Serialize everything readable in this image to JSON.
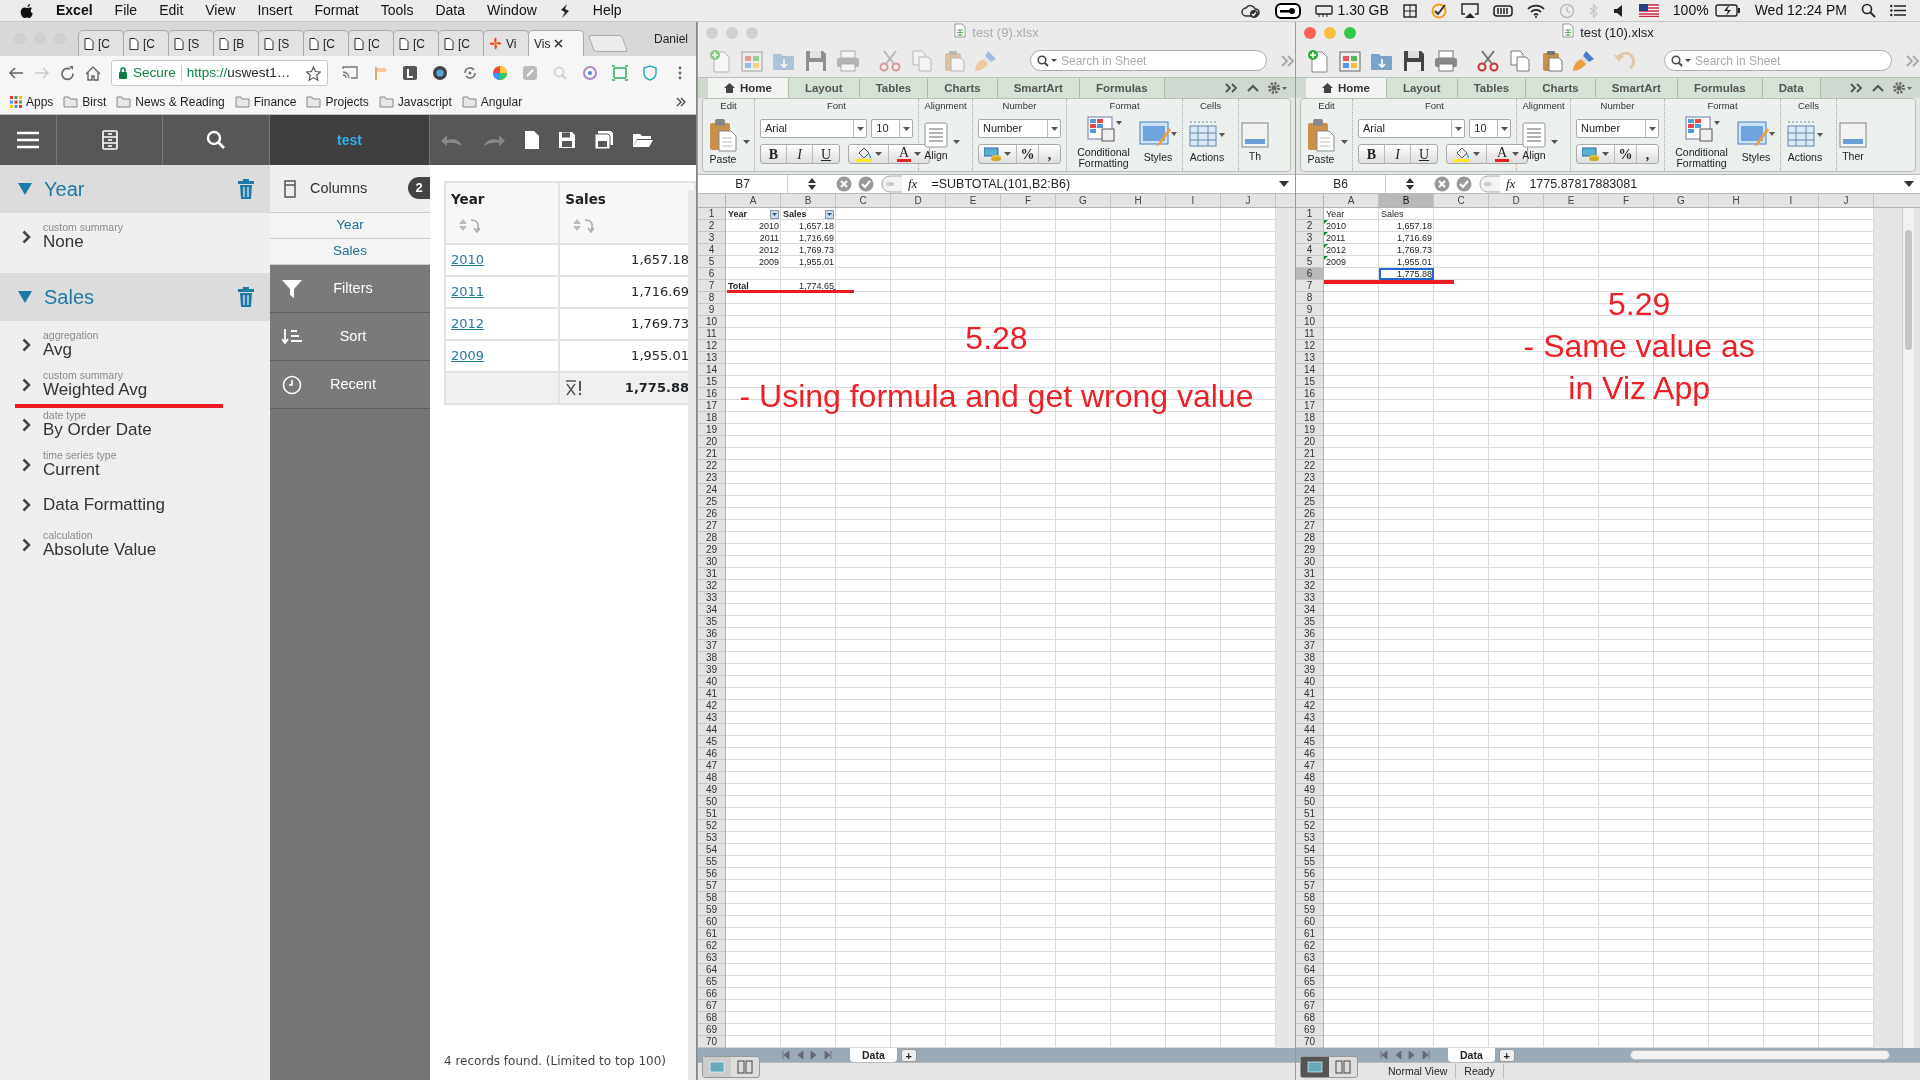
{
  "menu_bar": {
    "app": "Excel",
    "menus": [
      "File",
      "Edit",
      "View",
      "Insert",
      "Format",
      "Tools",
      "Data",
      "Window",
      "Help"
    ],
    "memory": "1.30 GB",
    "battery": "100%",
    "clock": "Wed 12:24 PM"
  },
  "browser": {
    "tabs": [
      {
        "label": "[C",
        "kind": "page",
        "selected": false
      },
      {
        "label": "[C",
        "kind": "page",
        "selected": false
      },
      {
        "label": "[S",
        "kind": "page",
        "selected": false
      },
      {
        "label": "[B",
        "kind": "page",
        "selected": false
      },
      {
        "label": "[S",
        "kind": "page",
        "selected": false
      },
      {
        "label": "[C",
        "kind": "page",
        "selected": false
      },
      {
        "label": "[C",
        "kind": "page",
        "selected": false
      },
      {
        "label": "[C",
        "kind": "page",
        "selected": false
      },
      {
        "label": "[C",
        "kind": "page",
        "selected": false
      },
      {
        "label": "Vi",
        "kind": "app",
        "selected": false
      },
      {
        "label": "Vis",
        "kind": "plain",
        "selected": true
      }
    ],
    "profile": "Daniel",
    "secure_label": "Secure",
    "url_scheme": "https://",
    "url_rest": "uswest1…",
    "bookmarks": [
      {
        "label": "Apps",
        "kind": "apps"
      },
      {
        "label": "Birst",
        "kind": "folder"
      },
      {
        "label": "News & Reading",
        "kind": "folder"
      },
      {
        "label": "Finance",
        "kind": "folder"
      },
      {
        "label": "Projects",
        "kind": "folder"
      },
      {
        "label": "Javascript",
        "kind": "folder"
      },
      {
        "label": "Angular",
        "kind": "folder"
      }
    ]
  },
  "viz_app": {
    "title": "test",
    "fields": [
      {
        "name": "Year",
        "expanded": true,
        "props": [
          {
            "label": "custom summary",
            "value": "None"
          }
        ]
      },
      {
        "name": "Sales",
        "expanded": true,
        "props": [
          {
            "label": "aggregation",
            "value": "Avg"
          },
          {
            "label": "custom summary",
            "value": "Weighted Avg"
          },
          {
            "label": "date type",
            "value": "By Order Date"
          },
          {
            "label": "time series type",
            "value": "Current"
          },
          {
            "value": "Data Formatting"
          },
          {
            "label": "calculation",
            "value": "Absolute Value"
          }
        ]
      }
    ],
    "columns": {
      "label": "Columns",
      "count": "2",
      "items": [
        "Year",
        "Sales"
      ]
    },
    "sections": [
      "Filters",
      "Sort",
      "Recent"
    ],
    "table": {
      "columns": [
        "Year",
        "Sales"
      ],
      "rows": [
        {
          "year": "2010",
          "sales": "1,657.18"
        },
        {
          "year": "2011",
          "sales": "1,716.69"
        },
        {
          "year": "2012",
          "sales": "1,769.73"
        },
        {
          "year": "2009",
          "sales": "1,955.01"
        }
      ],
      "total": "1,775.88"
    },
    "status": "4 records found. (Limited to top 100)"
  },
  "workbooks": [
    {
      "title": "test (9).xlsx",
      "focused": false,
      "undo": false,
      "search_placeholder": "Search in Sheet",
      "ribbon_tabs": [
        {
          "label": "Home",
          "selected": true
        },
        {
          "label": "Layout",
          "selected": false
        },
        {
          "label": "Tables",
          "selected": false
        },
        {
          "label": "Charts",
          "selected": false
        },
        {
          "label": "SmartArt",
          "selected": false
        },
        {
          "label": "Formulas",
          "selected": false
        }
      ],
      "group_labels": [
        "Edit",
        "Font",
        "Alignment",
        "Number",
        "Format",
        "Cells"
      ],
      "paste": "Paste",
      "font": "Arial",
      "font_size": "10",
      "style_buttons": [
        "B",
        "I",
        "U"
      ],
      "font_color": "A",
      "align": "Align",
      "number_format": "Number",
      "number_buttons": [
        "%",
        ","
      ],
      "format_buttons": [
        "Conditional Formatting",
        "Styles"
      ],
      "actions": "Actions",
      "themes": "Th",
      "name_box": "B7",
      "fx": "fx",
      "formula": "=SUBTOTAL(101,B2:B6)",
      "columns": [
        {
          "label": "A",
          "selected": false
        },
        {
          "label": "B",
          "selected": false
        },
        {
          "label": "C",
          "selected": false
        },
        {
          "label": "D",
          "selected": false
        },
        {
          "label": "E",
          "selected": false
        },
        {
          "label": "F",
          "selected": false
        },
        {
          "label": "G",
          "selected": false
        },
        {
          "label": "H",
          "selected": false
        },
        {
          "label": "I",
          "selected": false
        },
        {
          "label": "J",
          "selected": false
        }
      ],
      "row_headers": [
        {
          "label": "1",
          "selected": false
        },
        {
          "label": "2",
          "selected": false
        },
        {
          "label": "3",
          "selected": false
        },
        {
          "label": "4",
          "selected": false
        },
        {
          "label": "5",
          "selected": false
        },
        {
          "label": "6",
          "selected": false
        },
        {
          "label": "7",
          "selected": false
        },
        {
          "label": "8",
          "selected": false
        },
        {
          "label": "9",
          "selected": false
        },
        {
          "label": "10",
          "selected": false
        },
        {
          "label": "11",
          "selected": false
        },
        {
          "label": "12",
          "selected": false
        },
        {
          "label": "13",
          "selected": false
        },
        {
          "label": "14",
          "selected": false
        },
        {
          "label": "15",
          "selected": false
        },
        {
          "label": "16",
          "selected": false
        },
        {
          "label": "17",
          "selected": false
        },
        {
          "label": "18",
          "selected": false
        },
        {
          "label": "19",
          "selected": false
        },
        {
          "label": "20",
          "selected": false
        },
        {
          "label": "21",
          "selected": false
        },
        {
          "label": "22",
          "selected": false
        },
        {
          "label": "23",
          "selected": false
        },
        {
          "label": "24",
          "selected": false
        },
        {
          "label": "25",
          "selected": false
        },
        {
          "label": "26",
          "selected": false
        },
        {
          "label": "27",
          "selected": false
        },
        {
          "label": "28",
          "selected": false
        },
        {
          "label": "29",
          "selected": false
        },
        {
          "label": "30",
          "selected": false
        },
        {
          "label": "31",
          "selected": false
        },
        {
          "label": "32",
          "selected": false
        },
        {
          "label": "33",
          "selected": false
        },
        {
          "label": "34",
          "selected": false
        },
        {
          "label": "35",
          "selected": false
        },
        {
          "label": "36",
          "selected": false
        },
        {
          "label": "37",
          "selected": false
        },
        {
          "label": "38",
          "selected": false
        },
        {
          "label": "39",
          "selected": false
        },
        {
          "label": "40",
          "selected": false
        },
        {
          "label": "41",
          "selected": false
        },
        {
          "label": "42",
          "selected": false
        },
        {
          "label": "43",
          "selected": false
        },
        {
          "label": "44",
          "selected": false
        },
        {
          "label": "45",
          "selected": false
        },
        {
          "label": "46",
          "selected": false
        },
        {
          "label": "47",
          "selected": false
        },
        {
          "label": "48",
          "selected": false
        },
        {
          "label": "49",
          "selected": false
        },
        {
          "label": "50",
          "selected": false
        },
        {
          "label": "51",
          "selected": false
        },
        {
          "label": "52",
          "selected": false
        },
        {
          "label": "53",
          "selected": false
        },
        {
          "label": "54",
          "selected": false
        },
        {
          "label": "55",
          "selected": false
        },
        {
          "label": "56",
          "selected": false
        },
        {
          "label": "57",
          "selected": false
        },
        {
          "label": "58",
          "selected": false
        },
        {
          "label": "59",
          "selected": false
        },
        {
          "label": "60",
          "selected": false
        },
        {
          "label": "61",
          "selected": false
        },
        {
          "label": "62",
          "selected": false
        },
        {
          "label": "63",
          "selected": false
        },
        {
          "label": "64",
          "selected": false
        },
        {
          "label": "65",
          "selected": false
        },
        {
          "label": "66",
          "selected": false
        },
        {
          "label": "67",
          "selected": false
        },
        {
          "label": "68",
          "selected": false
        },
        {
          "label": "69",
          "selected": false
        },
        {
          "label": "70",
          "selected": false
        }
      ],
      "rows": [
        [
          {
            "kind": "text",
            "text": "Year",
            "bold": true,
            "filter": true
          },
          {
            "kind": "text",
            "text": "Sales",
            "bold": true,
            "filter": true
          }
        ],
        [
          {
            "kind": "number",
            "text": "2010"
          },
          {
            "kind": "number",
            "text": "1,657.18"
          }
        ],
        [
          {
            "kind": "number",
            "text": "2011"
          },
          {
            "kind": "number",
            "text": "1,716.69"
          }
        ],
        [
          {
            "kind": "number",
            "text": "2012"
          },
          {
            "kind": "number",
            "text": "1,769.73"
          }
        ],
        [
          {
            "kind": "number",
            "text": "2009"
          },
          {
            "kind": "number",
            "text": "1,955.01"
          }
        ],
        [
          {
            "kind": "blank"
          },
          {
            "kind": "blank"
          }
        ],
        [
          {
            "kind": "text",
            "text": "Total",
            "bold": true
          },
          {
            "kind": "number",
            "text": "1,774.65",
            "selected": true
          }
        ]
      ],
      "sheet_tabs": [
        {
          "label": "Data",
          "selected": true
        }
      ],
      "add_sheet": "+",
      "annotation": [
        "5.28",
        "- Using formula and get wrong value"
      ]
    },
    {
      "title": "test (10).xlsx",
      "focused": true,
      "undo": true,
      "search_placeholder": "Search in Sheet",
      "ribbon_tabs": [
        {
          "label": "Home",
          "selected": true
        },
        {
          "label": "Layout",
          "selected": false
        },
        {
          "label": "Tables",
          "selected": false
        },
        {
          "label": "Charts",
          "selected": false
        },
        {
          "label": "SmartArt",
          "selected": false
        },
        {
          "label": "Formulas",
          "selected": false
        },
        {
          "label": "Data",
          "selected": false
        }
      ],
      "group_labels": [
        "Edit",
        "Font",
        "Alignment",
        "Number",
        "Format",
        "Cells"
      ],
      "paste": "Paste",
      "font": "Arial",
      "font_size": "10",
      "style_buttons": [
        "B",
        "I",
        "U"
      ],
      "font_color": "A",
      "align": "Align",
      "number_format": "Number",
      "number_buttons": [
        "%",
        ","
      ],
      "format_buttons": [
        "Conditional Formatting",
        "Styles"
      ],
      "actions": "Actions",
      "themes": "Ther",
      "name_box": "B6",
      "fx": "fx",
      "formula": "1775.87817883081",
      "columns": [
        {
          "label": "A",
          "selected": false
        },
        {
          "label": "B",
          "selected": true
        },
        {
          "label": "C",
          "selected": false
        },
        {
          "label": "D",
          "selected": false
        },
        {
          "label": "E",
          "selected": false
        },
        {
          "label": "F",
          "selected": false
        },
        {
          "label": "G",
          "selected": false
        },
        {
          "label": "H",
          "selected": false
        },
        {
          "label": "I",
          "selected": false
        },
        {
          "label": "J",
          "selected": false
        }
      ],
      "row_headers": [
        {
          "label": "1",
          "selected": false
        },
        {
          "label": "2",
          "selected": false
        },
        {
          "label": "3",
          "selected": false
        },
        {
          "label": "4",
          "selected": false
        },
        {
          "label": "5",
          "selected": false
        },
        {
          "label": "6",
          "selected": true
        },
        {
          "label": "7",
          "selected": false
        },
        {
          "label": "8",
          "selected": false
        },
        {
          "label": "9",
          "selected": false
        },
        {
          "label": "10",
          "selected": false
        },
        {
          "label": "11",
          "selected": false
        },
        {
          "label": "12",
          "selected": false
        },
        {
          "label": "13",
          "selected": false
        },
        {
          "label": "14",
          "selected": false
        },
        {
          "label": "15",
          "selected": false
        },
        {
          "label": "16",
          "selected": false
        },
        {
          "label": "17",
          "selected": false
        },
        {
          "label": "18",
          "selected": false
        },
        {
          "label": "19",
          "selected": false
        },
        {
          "label": "20",
          "selected": false
        },
        {
          "label": "21",
          "selected": false
        },
        {
          "label": "22",
          "selected": false
        },
        {
          "label": "23",
          "selected": false
        },
        {
          "label": "24",
          "selected": false
        },
        {
          "label": "25",
          "selected": false
        },
        {
          "label": "26",
          "selected": false
        },
        {
          "label": "27",
          "selected": false
        },
        {
          "label": "28",
          "selected": false
        },
        {
          "label": "29",
          "selected": false
        },
        {
          "label": "30",
          "selected": false
        },
        {
          "label": "31",
          "selected": false
        },
        {
          "label": "32",
          "selected": false
        },
        {
          "label": "33",
          "selected": false
        },
        {
          "label": "34",
          "selected": false
        },
        {
          "label": "35",
          "selected": false
        },
        {
          "label": "36",
          "selected": false
        },
        {
          "label": "37",
          "selected": false
        },
        {
          "label": "38",
          "selected": false
        },
        {
          "label": "39",
          "selected": false
        },
        {
          "label": "40",
          "selected": false
        },
        {
          "label": "41",
          "selected": false
        },
        {
          "label": "42",
          "selected": false
        },
        {
          "label": "43",
          "selected": false
        },
        {
          "label": "44",
          "selected": false
        },
        {
          "label": "45",
          "selected": false
        },
        {
          "label": "46",
          "selected": false
        },
        {
          "label": "47",
          "selected": false
        },
        {
          "label": "48",
          "selected": false
        },
        {
          "label": "49",
          "selected": false
        },
        {
          "label": "50",
          "selected": false
        },
        {
          "label": "51",
          "selected": false
        },
        {
          "label": "52",
          "selected": false
        },
        {
          "label": "53",
          "selected": false
        },
        {
          "label": "54",
          "selected": false
        },
        {
          "label": "55",
          "selected": false
        },
        {
          "label": "56",
          "selected": false
        },
        {
          "label": "57",
          "selected": false
        },
        {
          "label": "58",
          "selected": false
        },
        {
          "label": "59",
          "selected": false
        },
        {
          "label": "60",
          "selected": false
        },
        {
          "label": "61",
          "selected": false
        },
        {
          "label": "62",
          "selected": false
        },
        {
          "label": "63",
          "selected": false
        },
        {
          "label": "64",
          "selected": false
        },
        {
          "label": "65",
          "selected": false
        },
        {
          "label": "66",
          "selected": false
        },
        {
          "label": "67",
          "selected": false
        },
        {
          "label": "68",
          "selected": false
        },
        {
          "label": "69",
          "selected": false
        },
        {
          "label": "70",
          "selected": false
        }
      ],
      "rows": [
        [
          {
            "kind": "text",
            "text": "Year"
          },
          {
            "kind": "text",
            "text": "Sales"
          }
        ],
        [
          {
            "kind": "text",
            "text": "2010",
            "warning": true
          },
          {
            "kind": "number",
            "text": "1,657.18"
          }
        ],
        [
          {
            "kind": "text",
            "text": "2011",
            "warning": true
          },
          {
            "kind": "number",
            "text": "1,716.69"
          }
        ],
        [
          {
            "kind": "text",
            "text": "2012",
            "warning": true
          },
          {
            "kind": "number",
            "text": "1,769.73"
          }
        ],
        [
          {
            "kind": "text",
            "text": "2009",
            "warning": true
          },
          {
            "kind": "number",
            "text": "1,955.01"
          }
        ],
        [
          {
            "kind": "blank"
          },
          {
            "kind": "number",
            "text": "1,775.88",
            "selected": true
          }
        ]
      ],
      "sheet_tabs": [
        {
          "label": "Data",
          "selected": true
        }
      ],
      "add_sheet": "+",
      "status": [
        "Normal View",
        "Ready"
      ],
      "annotation": [
        "5.29",
        "- Same value as",
        "in Viz App"
      ]
    }
  ]
}
